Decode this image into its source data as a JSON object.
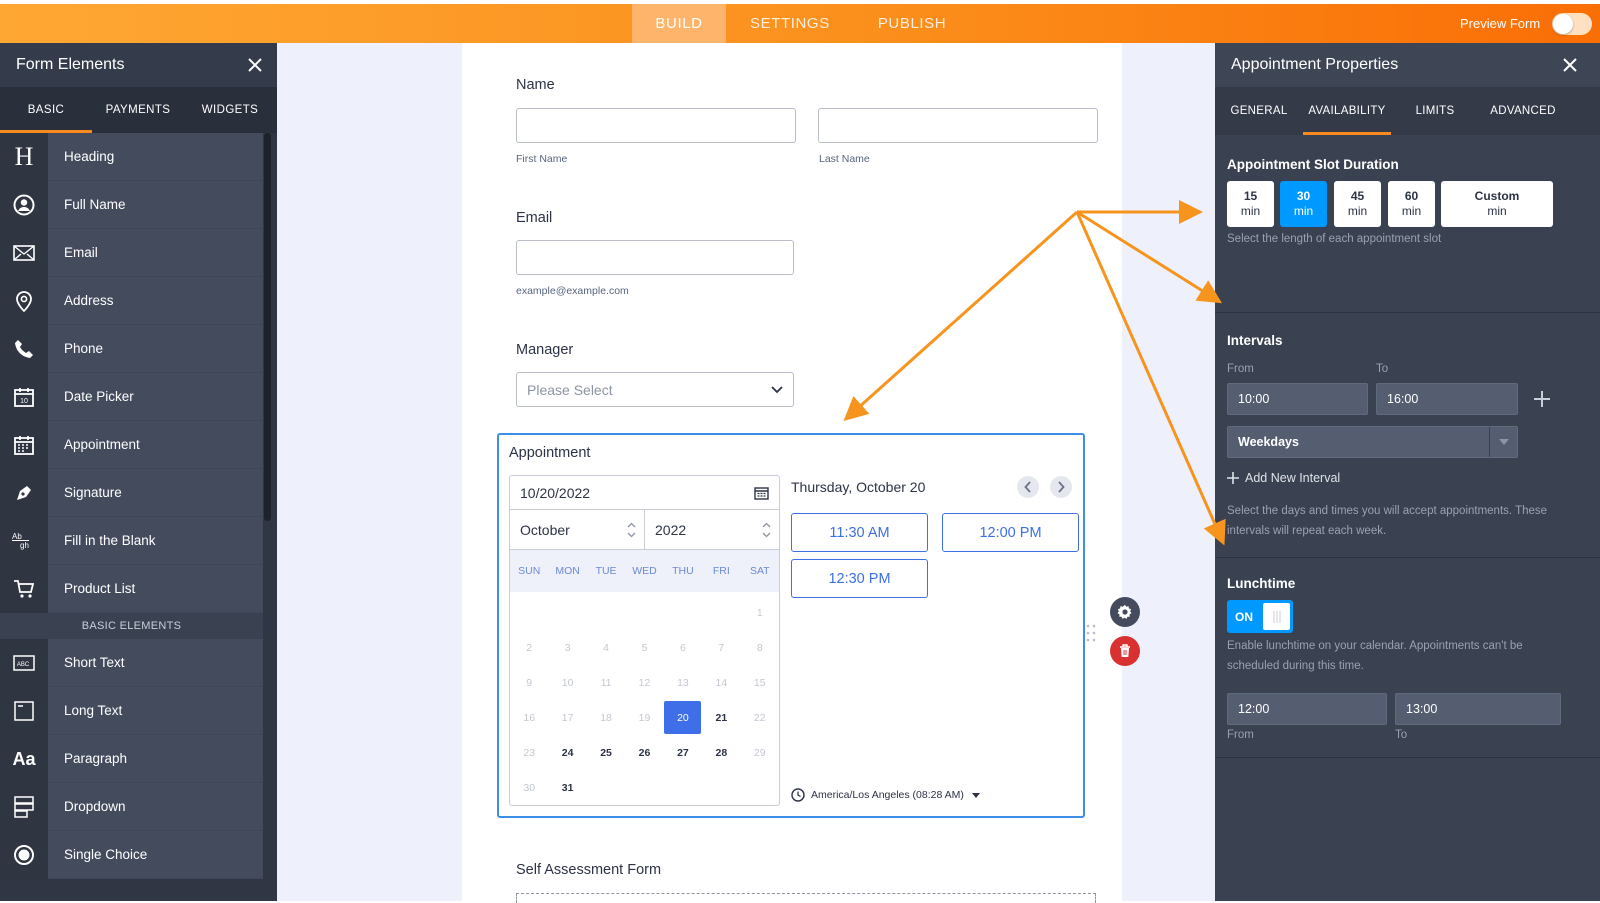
{
  "topbar": {
    "tabs": [
      "BUILD",
      "SETTINGS",
      "PUBLISH"
    ],
    "preview_label": "Preview Form"
  },
  "left_panel": {
    "title": "Form Elements",
    "tabs": [
      "BASIC",
      "PAYMENTS",
      "WIDGETS"
    ],
    "items": [
      {
        "label": "Heading",
        "icon": "heading-icon"
      },
      {
        "label": "Full Name",
        "icon": "user-icon"
      },
      {
        "label": "Email",
        "icon": "envelope-icon"
      },
      {
        "label": "Address",
        "icon": "map-pin-icon"
      },
      {
        "label": "Phone",
        "icon": "phone-icon"
      },
      {
        "label": "Date Picker",
        "icon": "calendar-icon"
      },
      {
        "label": "Appointment",
        "icon": "appointment-icon"
      },
      {
        "label": "Signature",
        "icon": "pen-icon"
      },
      {
        "label": "Fill in the Blank",
        "icon": "fill-blank-icon"
      },
      {
        "label": "Product List",
        "icon": "cart-icon"
      }
    ],
    "section": "BASIC ELEMENTS",
    "basic_items": [
      {
        "label": "Short Text",
        "icon": "short-text-icon"
      },
      {
        "label": "Long Text",
        "icon": "long-text-icon"
      },
      {
        "label": "Paragraph",
        "icon": "paragraph-icon"
      },
      {
        "label": "Dropdown",
        "icon": "dropdown-icon"
      },
      {
        "label": "Single Choice",
        "icon": "radio-icon"
      }
    ],
    "icon_glyphs": {
      "heading": "H",
      "fill_blank_top": "Ab",
      "fill_blank_bottom": "gh",
      "paragraph": "Aa",
      "short_text": "ABC"
    }
  },
  "form": {
    "name_label": "Name",
    "first_name": "First Name",
    "last_name": "Last Name",
    "email_label": "Email",
    "email_hint": "example@example.com",
    "manager_label": "Manager",
    "manager_placeholder": "Please Select",
    "appointment_label": "Appointment",
    "date_value": "10/20/2022",
    "month": "October",
    "year": "2022",
    "weekdays": [
      "SUN",
      "MON",
      "TUE",
      "WED",
      "THU",
      "FRI",
      "SAT"
    ],
    "day_header": "Thursday, October 20",
    "slots": [
      "11:30 AM",
      "12:00 PM",
      "12:30 PM"
    ],
    "timezone": "America/Los Angeles (08:28 AM)",
    "next_label": "Self Assessment Form"
  },
  "calendar": {
    "first_weekday": 6,
    "days_in_month": 31,
    "selected": 20,
    "available": [
      21,
      24,
      25,
      26,
      27,
      28,
      31
    ]
  },
  "right_panel": {
    "title": "Appointment Properties",
    "tabs": [
      "GENERAL",
      "AVAILABILITY",
      "LIMITS",
      "ADVANCED"
    ],
    "slot_duration": {
      "title": "Appointment Slot Duration",
      "options": [
        {
          "value": "15",
          "unit": "min"
        },
        {
          "value": "30",
          "unit": "min",
          "selected": true
        },
        {
          "value": "45",
          "unit": "min"
        },
        {
          "value": "60",
          "unit": "min"
        },
        {
          "value": "Custom",
          "unit": "min"
        }
      ],
      "hint": "Select the length of each appointment slot"
    },
    "intervals": {
      "title": "Intervals",
      "from_label": "From",
      "to_label": "To",
      "from": "10:00",
      "to": "16:00",
      "days": "Weekdays",
      "add_label": "Add New Interval",
      "hint": "Select the days and times you will accept appointments. These intervals will repeat each week."
    },
    "lunchtime": {
      "title": "Lunchtime",
      "toggle": "ON",
      "hint": "Enable lunchtime on your calendar. Appointments can't be scheduled during this time.",
      "from": "12:00",
      "to": "13:00",
      "from_label": "From",
      "to_label": "To"
    }
  },
  "colors": {
    "accent": "#fa8a1e",
    "selected_blue": "#3f6fe8",
    "duration_blue": "#0099ff",
    "arrow": "#f7941d"
  }
}
